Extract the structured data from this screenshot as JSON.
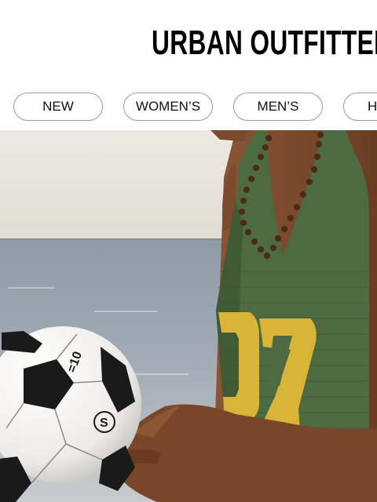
{
  "header": {
    "logo_text": "URBAN OUTFITTERS"
  },
  "nav": {
    "items": [
      {
        "label": "NEW"
      },
      {
        "label": "WOMEN’S"
      },
      {
        "label": "MEN’S"
      },
      {
        "label": "H"
      }
    ]
  },
  "hero": {
    "ball_text_1": "=10",
    "ball_logo": "S"
  }
}
